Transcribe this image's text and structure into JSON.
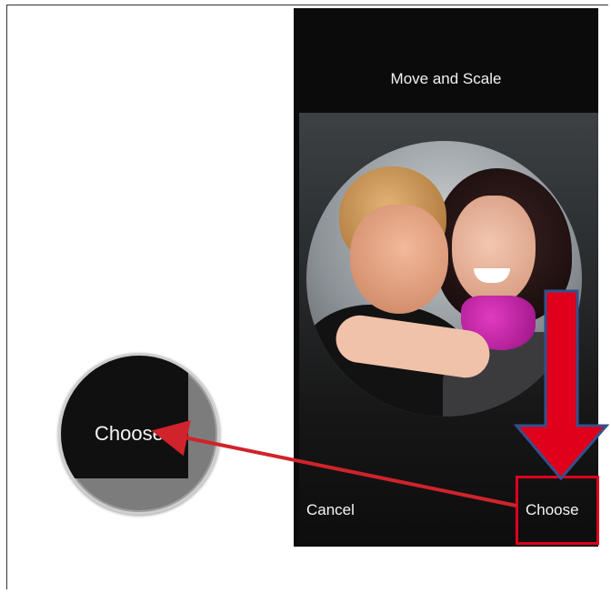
{
  "screen": {
    "title": "Move and Scale",
    "cancel_label": "Cancel",
    "choose_label": "Choose"
  },
  "zoom_callout": {
    "label": "Choose"
  },
  "colors": {
    "annotation_red": "#e0001b",
    "phone_background": "#0b0b0b"
  }
}
